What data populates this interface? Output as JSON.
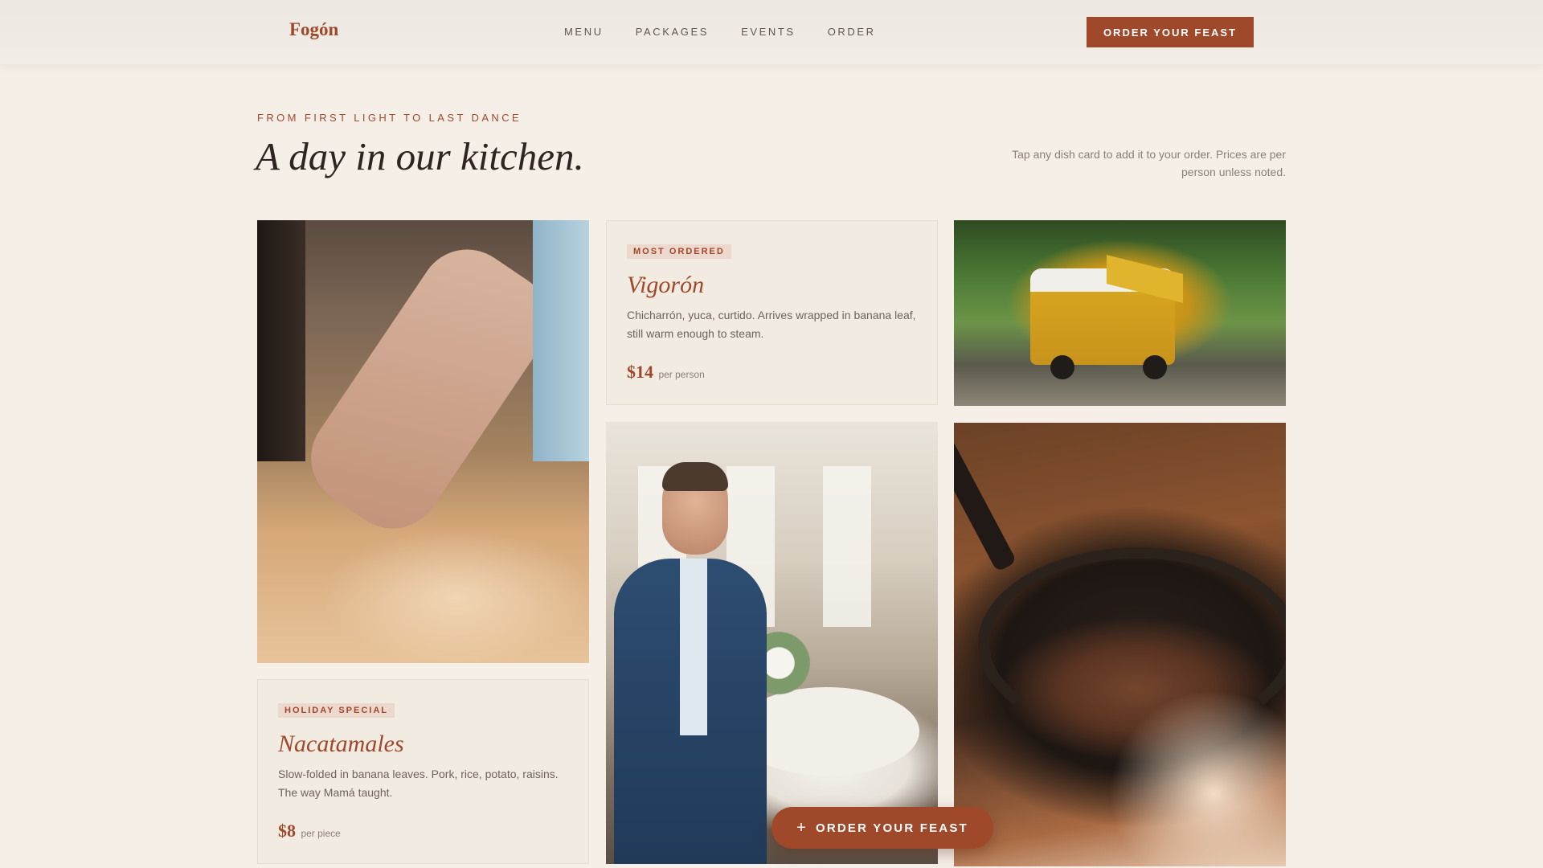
{
  "header": {
    "brand": "Fogón",
    "nav": [
      "MENU",
      "PACKAGES",
      "EVENTS",
      "ORDER"
    ],
    "cta_label": "ORDER YOUR FEAST"
  },
  "intro": {
    "eyebrow": "FROM FIRST LIGHT TO LAST DANCE",
    "headline": "A day in our kitchen.",
    "hint": "Tap any dish card to add it to your order. Prices are per person unless noted."
  },
  "dishes": [
    {
      "badge": "MOST ORDERED",
      "name": "Vigorón",
      "description": "Chicharrón, yuca, curtido. Arrives wrapped in banana leaf, still warm enough to steam.",
      "price": "$14",
      "unit": "per person"
    },
    {
      "badge": "HOLIDAY SPECIAL",
      "name": "Nacatamales",
      "description": "Slow-folded in banana leaves. Pork, rice, potato, raisins. The way Mamá taught.",
      "price": "$8",
      "unit": "per piece"
    }
  ],
  "floating_cta": {
    "icon": "plus-icon",
    "label": "ORDER YOUR FEAST"
  },
  "colors": {
    "accent": "#a0482a",
    "background": "#f5efe8",
    "card": "#f1ebe2"
  }
}
